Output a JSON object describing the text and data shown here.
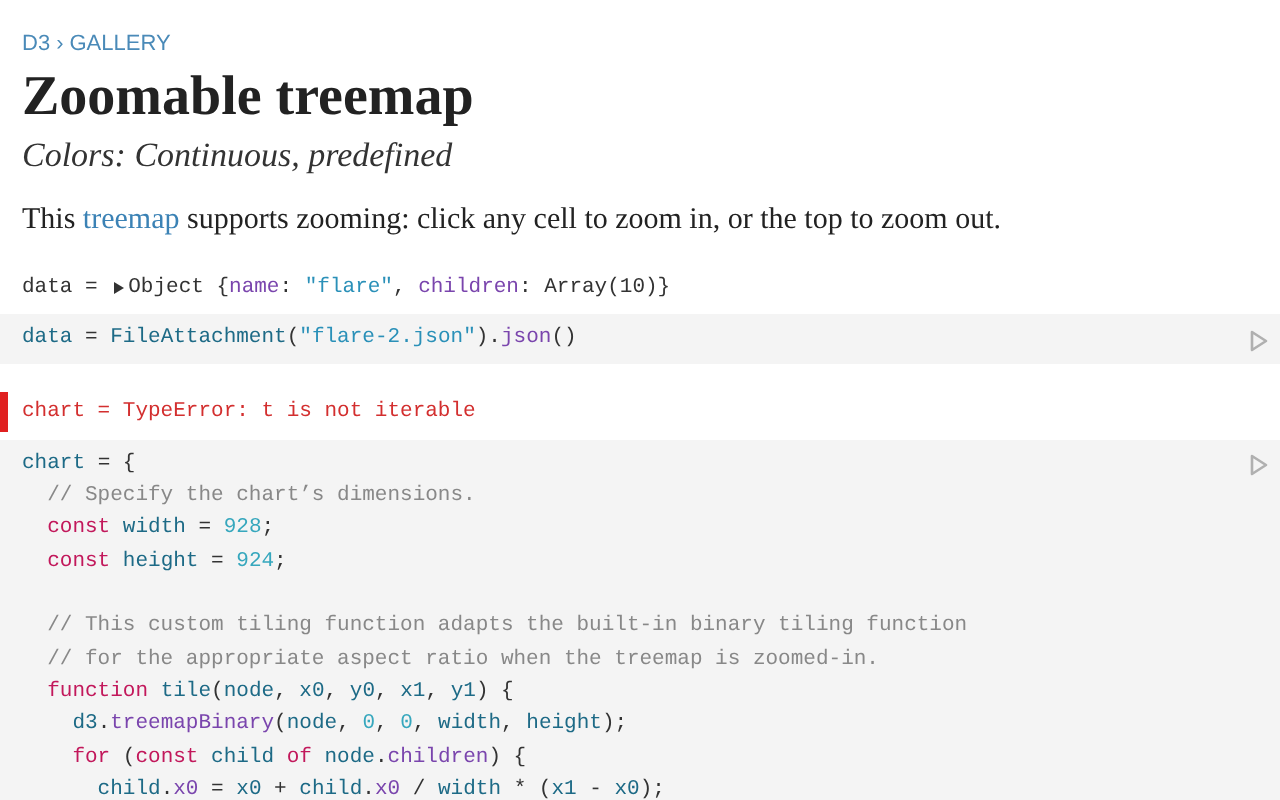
{
  "breadcrumb": {
    "items": [
      "D3",
      "GALLERY"
    ],
    "separator": "›"
  },
  "title": "Zoomable treemap",
  "subtitle": "Colors: Continuous, predefined",
  "intro": [
    {
      "kind": "plain",
      "text": "This "
    },
    {
      "kind": "link",
      "text": "treemap"
    },
    {
      "kind": "plain",
      "text": " supports zooming: click any cell to zoom in, or the top to zoom out."
    }
  ],
  "cells": [
    {
      "kind": "output",
      "expanded": false,
      "lines": [
        {
          "kind": "code",
          "tokens": [
            {
              "kind": "plain",
              "text": "data = "
            },
            {
              "kind": "toggle"
            },
            {
              "kind": "plain",
              "text": "Object {"
            },
            {
              "kind": "prop",
              "text": "name"
            },
            {
              "kind": "plain",
              "text": ": "
            },
            {
              "kind": "string",
              "text": "\"flare\""
            },
            {
              "kind": "plain",
              "text": ", "
            },
            {
              "kind": "prop",
              "text": "children"
            },
            {
              "kind": "plain",
              "text": ": Array(10)}"
            }
          ]
        }
      ]
    },
    {
      "kind": "code",
      "lines": [
        {
          "kind": "code",
          "tokens": [
            {
              "kind": "var",
              "text": "data"
            },
            {
              "kind": "plain",
              "text": " = "
            },
            {
              "kind": "var",
              "text": "FileAttachment"
            },
            {
              "kind": "plain",
              "text": "("
            },
            {
              "kind": "string",
              "text": "\"flare-2.json\""
            },
            {
              "kind": "plain",
              "text": ")."
            },
            {
              "kind": "prop",
              "text": "json"
            },
            {
              "kind": "plain",
              "text": "()"
            }
          ]
        }
      ]
    },
    {
      "kind": "error",
      "lines": [
        {
          "kind": "code",
          "tokens": [
            {
              "kind": "error",
              "text": "chart = TypeError: t is not iterable"
            }
          ]
        }
      ]
    },
    {
      "kind": "code",
      "lines": [
        {
          "kind": "code",
          "tokens": [
            {
              "kind": "var",
              "text": "chart"
            },
            {
              "kind": "plain",
              "text": " = {"
            }
          ]
        },
        {
          "kind": "code",
          "tokens": [
            {
              "kind": "comment",
              "text": "  // Specify the chart’s dimensions."
            }
          ]
        },
        {
          "kind": "code",
          "tokens": [
            {
              "kind": "keyword",
              "text": "  const "
            },
            {
              "kind": "var",
              "text": "width"
            },
            {
              "kind": "plain",
              "text": " = "
            },
            {
              "kind": "number",
              "text": "928"
            },
            {
              "kind": "plain",
              "text": ";"
            }
          ]
        },
        {
          "kind": "code",
          "tokens": [
            {
              "kind": "keyword",
              "text": "  const "
            },
            {
              "kind": "var",
              "text": "height"
            },
            {
              "kind": "plain",
              "text": " = "
            },
            {
              "kind": "number",
              "text": "924"
            },
            {
              "kind": "plain",
              "text": ";"
            }
          ]
        },
        {
          "kind": "blank"
        },
        {
          "kind": "code",
          "tokens": [
            {
              "kind": "comment",
              "text": "  // This custom tiling function adapts the built-in binary tiling function"
            }
          ]
        },
        {
          "kind": "code",
          "tokens": [
            {
              "kind": "comment",
              "text": "  // for the appropriate aspect ratio when the treemap is zoomed-in."
            }
          ]
        },
        {
          "kind": "code",
          "tokens": [
            {
              "kind": "keyword",
              "text": "  function "
            },
            {
              "kind": "var",
              "text": "tile"
            },
            {
              "kind": "plain",
              "text": "("
            },
            {
              "kind": "var",
              "text": "node"
            },
            {
              "kind": "plain",
              "text": ", "
            },
            {
              "kind": "var",
              "text": "x0"
            },
            {
              "kind": "plain",
              "text": ", "
            },
            {
              "kind": "var",
              "text": "y0"
            },
            {
              "kind": "plain",
              "text": ", "
            },
            {
              "kind": "var",
              "text": "x1"
            },
            {
              "kind": "plain",
              "text": ", "
            },
            {
              "kind": "var",
              "text": "y1"
            },
            {
              "kind": "plain",
              "text": ") {"
            }
          ]
        },
        {
          "kind": "code",
          "tokens": [
            {
              "kind": "var",
              "text": "    d3"
            },
            {
              "kind": "plain",
              "text": "."
            },
            {
              "kind": "prop",
              "text": "treemapBinary"
            },
            {
              "kind": "plain",
              "text": "("
            },
            {
              "kind": "var",
              "text": "node"
            },
            {
              "kind": "plain",
              "text": ", "
            },
            {
              "kind": "number",
              "text": "0"
            },
            {
              "kind": "plain",
              "text": ", "
            },
            {
              "kind": "number",
              "text": "0"
            },
            {
              "kind": "plain",
              "text": ", "
            },
            {
              "kind": "var",
              "text": "width"
            },
            {
              "kind": "plain",
              "text": ", "
            },
            {
              "kind": "var",
              "text": "height"
            },
            {
              "kind": "plain",
              "text": ");"
            }
          ]
        },
        {
          "kind": "code",
          "tokens": [
            {
              "kind": "keyword",
              "text": "    for"
            },
            {
              "kind": "plain",
              "text": " ("
            },
            {
              "kind": "keyword",
              "text": "const "
            },
            {
              "kind": "var",
              "text": "child "
            },
            {
              "kind": "keyword",
              "text": "of "
            },
            {
              "kind": "var",
              "text": "node"
            },
            {
              "kind": "plain",
              "text": "."
            },
            {
              "kind": "prop",
              "text": "children"
            },
            {
              "kind": "plain",
              "text": ") {"
            }
          ]
        },
        {
          "kind": "code",
          "tokens": [
            {
              "kind": "var",
              "text": "      child"
            },
            {
              "kind": "plain",
              "text": "."
            },
            {
              "kind": "prop",
              "text": "x0"
            },
            {
              "kind": "plain",
              "text": " = "
            },
            {
              "kind": "var",
              "text": "x0"
            },
            {
              "kind": "plain",
              "text": " + "
            },
            {
              "kind": "var",
              "text": "child"
            },
            {
              "kind": "plain",
              "text": "."
            },
            {
              "kind": "prop",
              "text": "x0"
            },
            {
              "kind": "plain",
              "text": " / "
            },
            {
              "kind": "var",
              "text": "width"
            },
            {
              "kind": "plain",
              "text": " * ("
            },
            {
              "kind": "var",
              "text": "x1"
            },
            {
              "kind": "plain",
              "text": " - "
            },
            {
              "kind": "var",
              "text": "x0"
            },
            {
              "kind": "plain",
              "text": ");"
            }
          ]
        }
      ]
    }
  ]
}
